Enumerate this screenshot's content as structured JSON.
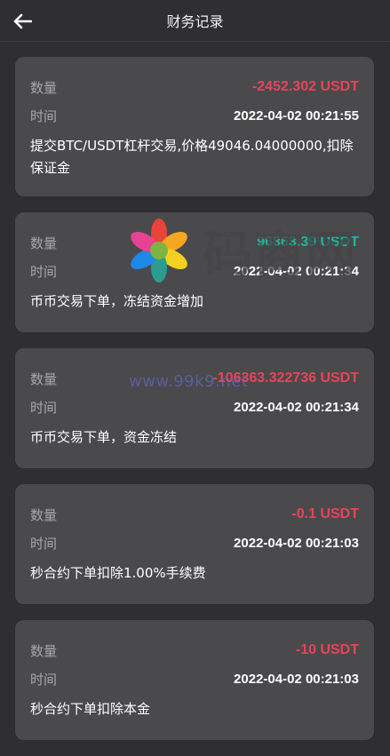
{
  "header": {
    "title": "财务记录",
    "back_icon": "arrow-left-icon"
  },
  "labels": {
    "amount": "数量",
    "time": "时间"
  },
  "colors": {
    "negative": "#e8445a",
    "positive": "#19b89a",
    "background": "#2f2f31",
    "card": "#4a4a4c"
  },
  "records": [
    {
      "amount": "-2452.302 USDT",
      "amount_type": "negative",
      "time": "2022-04-02 00:21:55",
      "description": "提交BTC/USDT杠杆交易,价格49046.04000000,扣除保证金"
    },
    {
      "amount": "96363.39 USDT",
      "amount_type": "positive",
      "time": "2022-04-02 00:21:34",
      "description": "币币交易下单，冻结资金增加"
    },
    {
      "amount": "-106363.322736 USDT",
      "amount_type": "negative",
      "time": "2022-04-02 00:21:34",
      "description": "币币交易下单，资金冻结"
    },
    {
      "amount": "-0.1 USDT",
      "amount_type": "negative",
      "time": "2022-04-02 00:21:03",
      "description": "秒合约下单扣除1.00%手续费"
    },
    {
      "amount": "-10 USDT",
      "amount_type": "negative",
      "time": "2022-04-02 00:21:03",
      "description": "秒合约下单扣除本金"
    }
  ],
  "watermark": {
    "url": "www.99k9.net",
    "text": "码商网"
  }
}
